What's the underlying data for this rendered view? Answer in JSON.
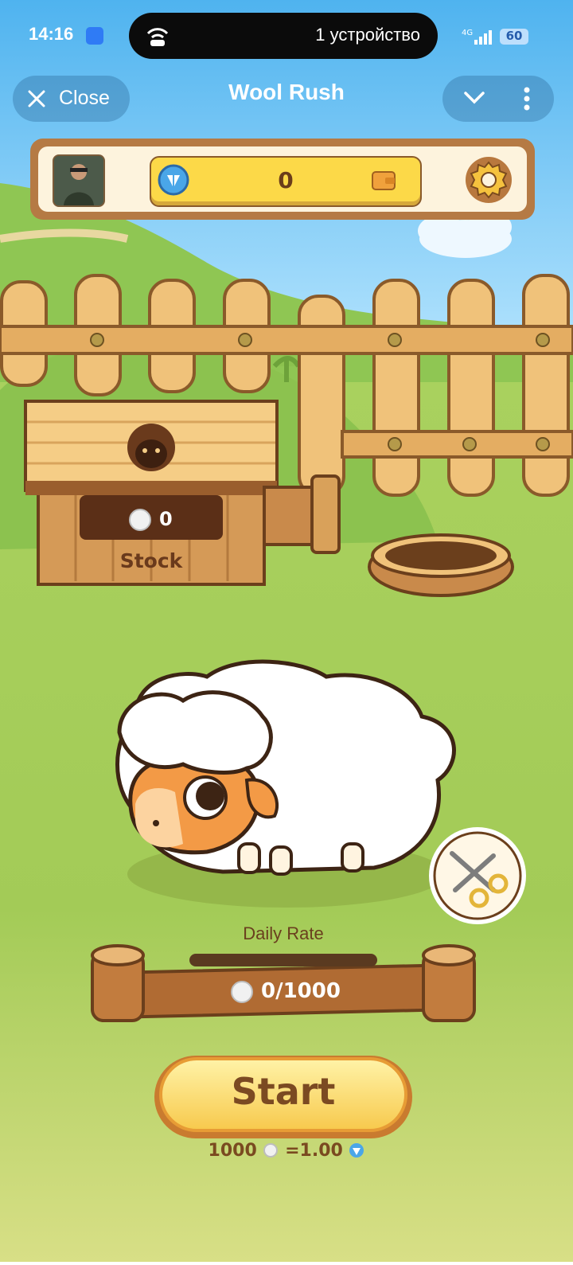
{
  "status_bar": {
    "time": "14:16",
    "pill_text": "1 устройство",
    "network": "4G",
    "battery": "60"
  },
  "header": {
    "close_label": "Close",
    "title": "Wool Rush"
  },
  "wallet": {
    "balance": "0",
    "icons": [
      "diamond-token-icon",
      "wallet-icon",
      "gear-icon"
    ]
  },
  "stock": {
    "value": "0",
    "label": "Stock"
  },
  "daily": {
    "label": "Daily Rate",
    "progress_text": "0/1000",
    "progress_fraction": 0
  },
  "actions": {
    "start_label": "Start",
    "rate_left": "1000",
    "rate_right": "=1.00"
  },
  "colors": {
    "sky": "#7cc8f2",
    "grass": "#9fcb55",
    "button_yellow": "#fcd948",
    "wood": "#c98a4b"
  }
}
